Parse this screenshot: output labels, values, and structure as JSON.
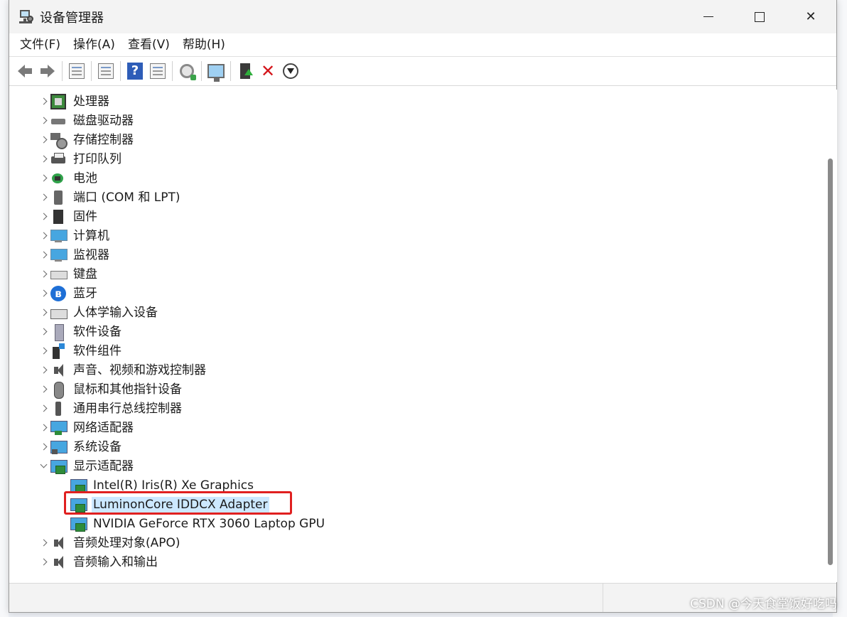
{
  "window": {
    "title": "设备管理器",
    "caption": {
      "minimize": "—",
      "maximize": "□",
      "close": "✕"
    }
  },
  "menubar": {
    "items": [
      {
        "label": "文件(F)"
      },
      {
        "label": "操作(A)"
      },
      {
        "label": "查看(V)"
      },
      {
        "label": "帮助(H)"
      }
    ]
  },
  "toolbar": {
    "buttons": [
      "back-icon",
      "forward-icon",
      "show-hide-tree-icon",
      "properties-icon",
      "help-icon",
      "action-view-icon",
      "scan-hardware-icon",
      "monitor-icon",
      "update-driver-icon",
      "uninstall-icon",
      "disable-icon"
    ]
  },
  "tree": {
    "categories": [
      {
        "label": "处理器",
        "icon": "processor-icon",
        "expanded": false
      },
      {
        "label": "磁盘驱动器",
        "icon": "disk-drive-icon",
        "expanded": false
      },
      {
        "label": "存储控制器",
        "icon": "storage-controller-icon",
        "expanded": false
      },
      {
        "label": "打印队列",
        "icon": "printer-icon",
        "expanded": false
      },
      {
        "label": "电池",
        "icon": "battery-icon",
        "expanded": false
      },
      {
        "label": "端口 (COM 和 LPT)",
        "icon": "port-icon",
        "expanded": false
      },
      {
        "label": "固件",
        "icon": "firmware-icon",
        "expanded": false
      },
      {
        "label": "计算机",
        "icon": "computer-icon",
        "expanded": false
      },
      {
        "label": "监视器",
        "icon": "monitor-icon",
        "expanded": false
      },
      {
        "label": "键盘",
        "icon": "keyboard-icon",
        "expanded": false
      },
      {
        "label": "蓝牙",
        "icon": "bluetooth-icon",
        "expanded": false
      },
      {
        "label": "人体学输入设备",
        "icon": "hid-icon",
        "expanded": false
      },
      {
        "label": "软件设备",
        "icon": "software-device-icon",
        "expanded": false
      },
      {
        "label": "软件组件",
        "icon": "software-component-icon",
        "expanded": false
      },
      {
        "label": "声音、视频和游戏控制器",
        "icon": "sound-icon",
        "expanded": false
      },
      {
        "label": "鼠标和其他指针设备",
        "icon": "mouse-icon",
        "expanded": false
      },
      {
        "label": "通用串行总线控制器",
        "icon": "usb-icon",
        "expanded": false
      },
      {
        "label": "网络适配器",
        "icon": "network-adapter-icon",
        "expanded": false
      },
      {
        "label": "系统设备",
        "icon": "system-device-icon",
        "expanded": false
      },
      {
        "label": "显示适配器",
        "icon": "display-adapter-icon",
        "expanded": true,
        "children": [
          {
            "label": "Intel(R) Iris(R) Xe Graphics",
            "selected": false
          },
          {
            "label": "LuminonCore IDDCX Adapter",
            "selected": true,
            "highlighted": true
          },
          {
            "label": "NVIDIA GeForce RTX 3060 Laptop GPU",
            "selected": false
          }
        ]
      },
      {
        "label": "音频处理对象(APO)",
        "icon": "audio-processing-icon",
        "expanded": false
      },
      {
        "label": "音频输入和输出",
        "icon": "audio-io-icon",
        "expanded": false
      }
    ]
  },
  "watermark": "CSDN @今天食堂饭好吃吗",
  "colors": {
    "selection": "#cce8ff",
    "highlight_border": "#e02020",
    "titlebar_bg": "#f3f3f3"
  }
}
